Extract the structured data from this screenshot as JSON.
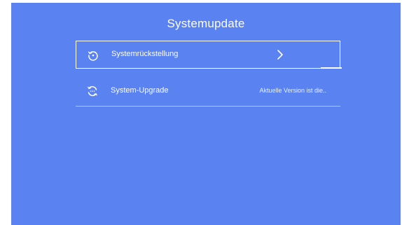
{
  "header": {
    "title": "Systemupdate"
  },
  "menu": {
    "items": [
      {
        "label": "Systemrückstellung",
        "icon": "reset-icon",
        "trailing_icon": "chevron-right-icon",
        "selected": true
      },
      {
        "label": "System-Upgrade",
        "icon": "upgrade-icon",
        "value": "Aktuelle Version ist die..",
        "selected": false
      }
    ]
  },
  "colors": {
    "background": "#5a82f0",
    "text": "#ffffff"
  }
}
